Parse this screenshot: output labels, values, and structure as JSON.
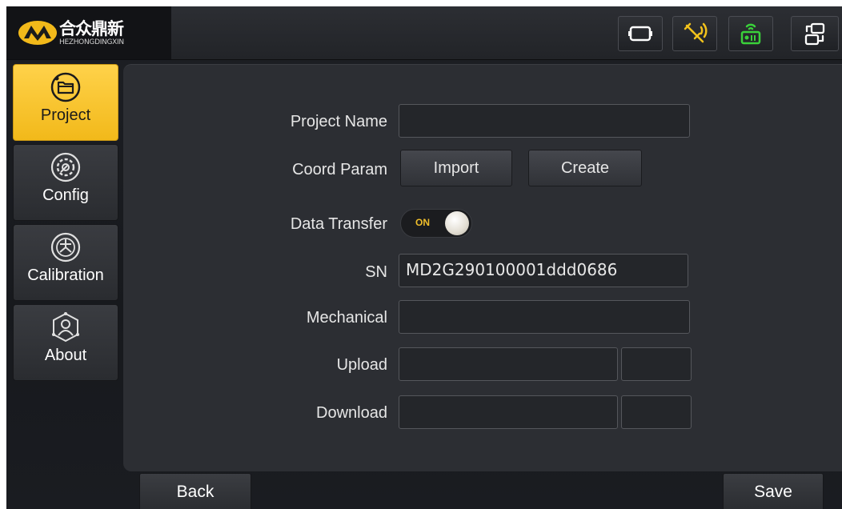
{
  "brand": {
    "name_cn": "合众鼎新",
    "name_en": "HEZHONGDINGXIN",
    "accent": "#f2b91a"
  },
  "toolbar": {
    "icons": [
      "screen-icon",
      "satellite-icon",
      "radio-icon",
      "switch-icon"
    ],
    "satellite_color": "#f2c21c",
    "radio_color": "#3ad13a"
  },
  "sidebar": {
    "items": [
      {
        "label": "Project",
        "icon": "folder-icon",
        "active": true
      },
      {
        "label": "Config",
        "icon": "gear-icon",
        "active": false
      },
      {
        "label": "Calibration",
        "icon": "calibration-icon",
        "active": false
      },
      {
        "label": "About",
        "icon": "about-icon",
        "active": false
      }
    ]
  },
  "form": {
    "project_name_label": "Project Name",
    "project_name_value": "",
    "coord_param_label": "Coord Param",
    "import_label": "Import",
    "create_label": "Create",
    "data_transfer_label": "Data Transfer",
    "data_transfer_state": "ON",
    "sn_label": "SN",
    "sn_value": "MD2G290100001ddd0686",
    "mechanical_label": "Mechanical",
    "mechanical_value": "",
    "upload_label": "Upload",
    "upload_value": "",
    "upload_extra": "",
    "download_label": "Download",
    "download_value": "",
    "download_extra": ""
  },
  "footer": {
    "back_label": "Back",
    "save_label": "Save"
  }
}
